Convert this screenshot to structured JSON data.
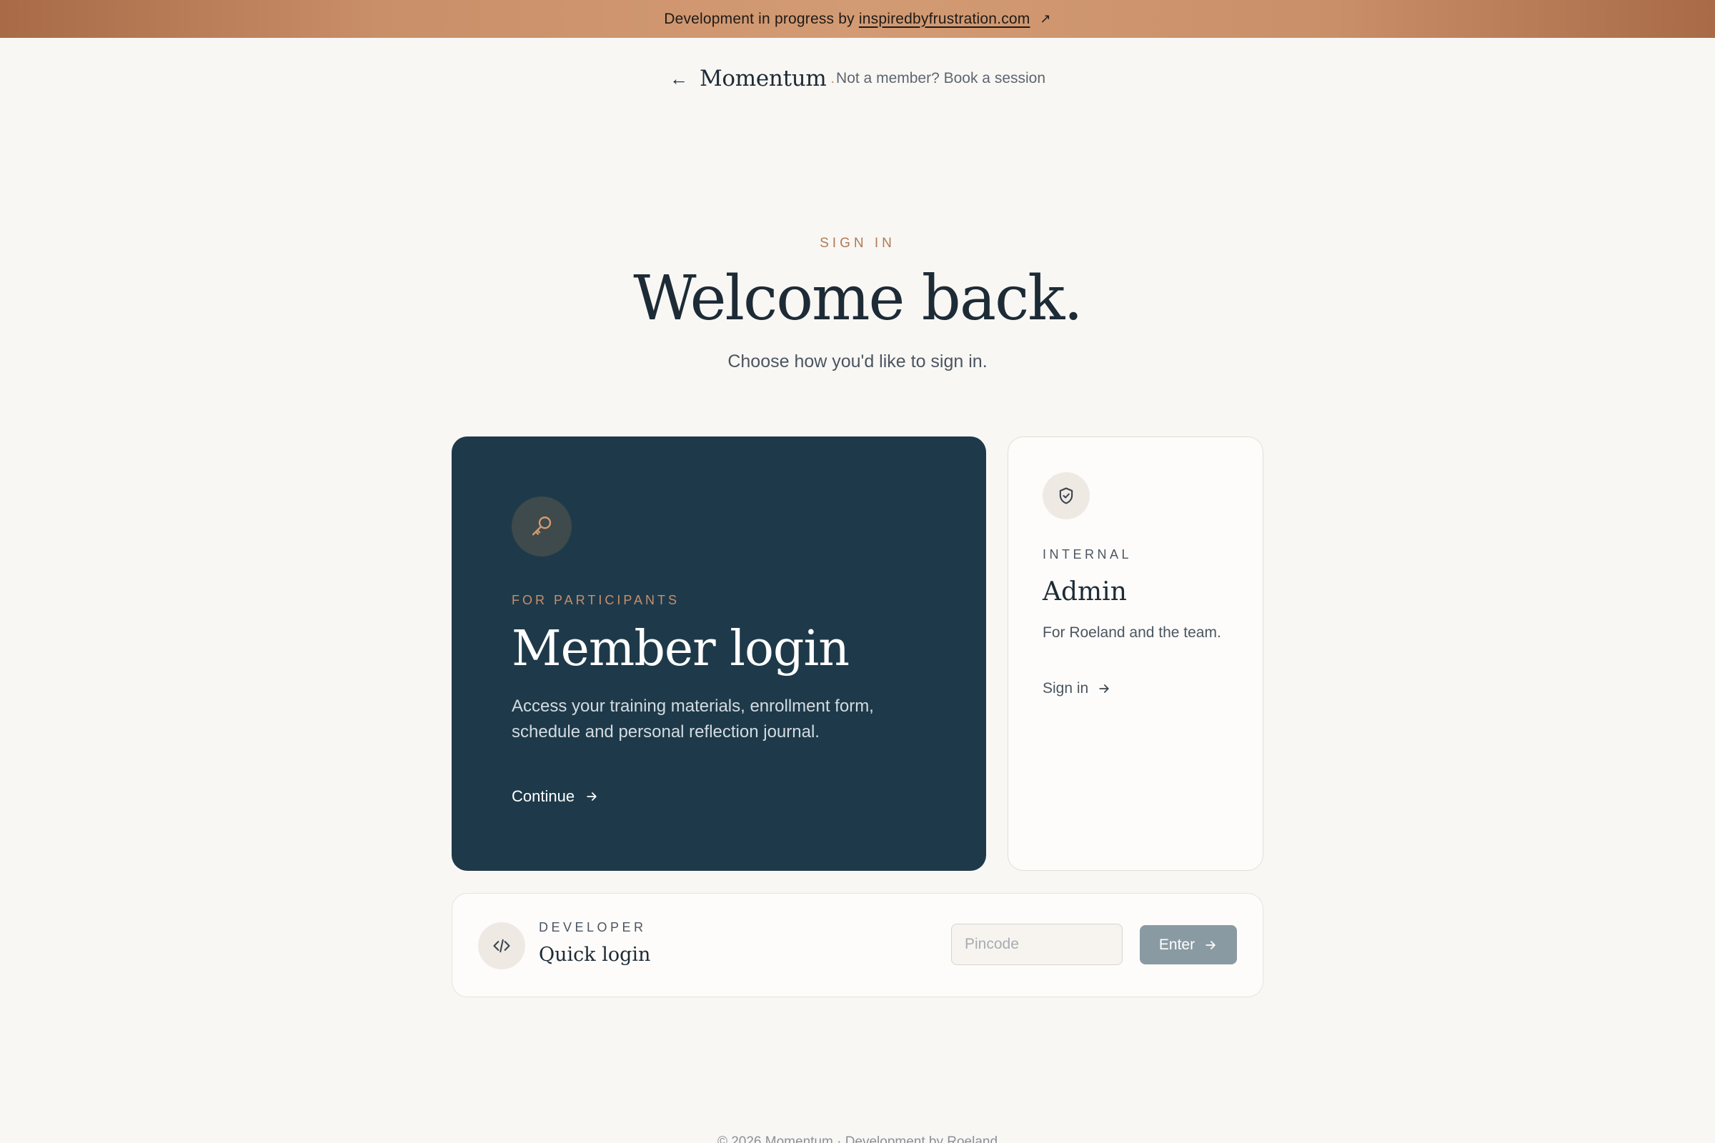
{
  "banner": {
    "prefix": "Development in progress by",
    "link_text": "inspiredbyfrustration.com",
    "external_icon": "↗"
  },
  "header": {
    "back_icon": "←",
    "brand": "Momentum",
    "brand_dot": ".",
    "member_link": "Not a member? Book a session"
  },
  "hero": {
    "eyebrow": "SIGN IN",
    "title": "Welcome back.",
    "subtitle": "Choose how you'd like to sign in."
  },
  "member_card": {
    "icon": "key-icon",
    "eyebrow": "FOR PARTICIPANTS",
    "title": "Member login",
    "description": "Access your training materials, enrollment form, schedule and personal reflection journal.",
    "cta": "Continue"
  },
  "admin_card": {
    "icon": "shield-check-icon",
    "eyebrow": "INTERNAL",
    "title": "Admin",
    "description": "For Roeland and the team.",
    "cta": "Sign in"
  },
  "developer": {
    "icon": "code-icon",
    "eyebrow": "DEVELOPER",
    "title": "Quick login",
    "pin_placeholder": "Pincode",
    "pin_value": "",
    "enter_label": "Enter"
  },
  "footer": {
    "text": "© 2026 Momentum · Development by Roeland"
  },
  "colors": {
    "accent": "#c98f68",
    "navy": "#1e3a4a",
    "background": "#f9f7f4",
    "button_disabled": "#8a9aa3"
  }
}
